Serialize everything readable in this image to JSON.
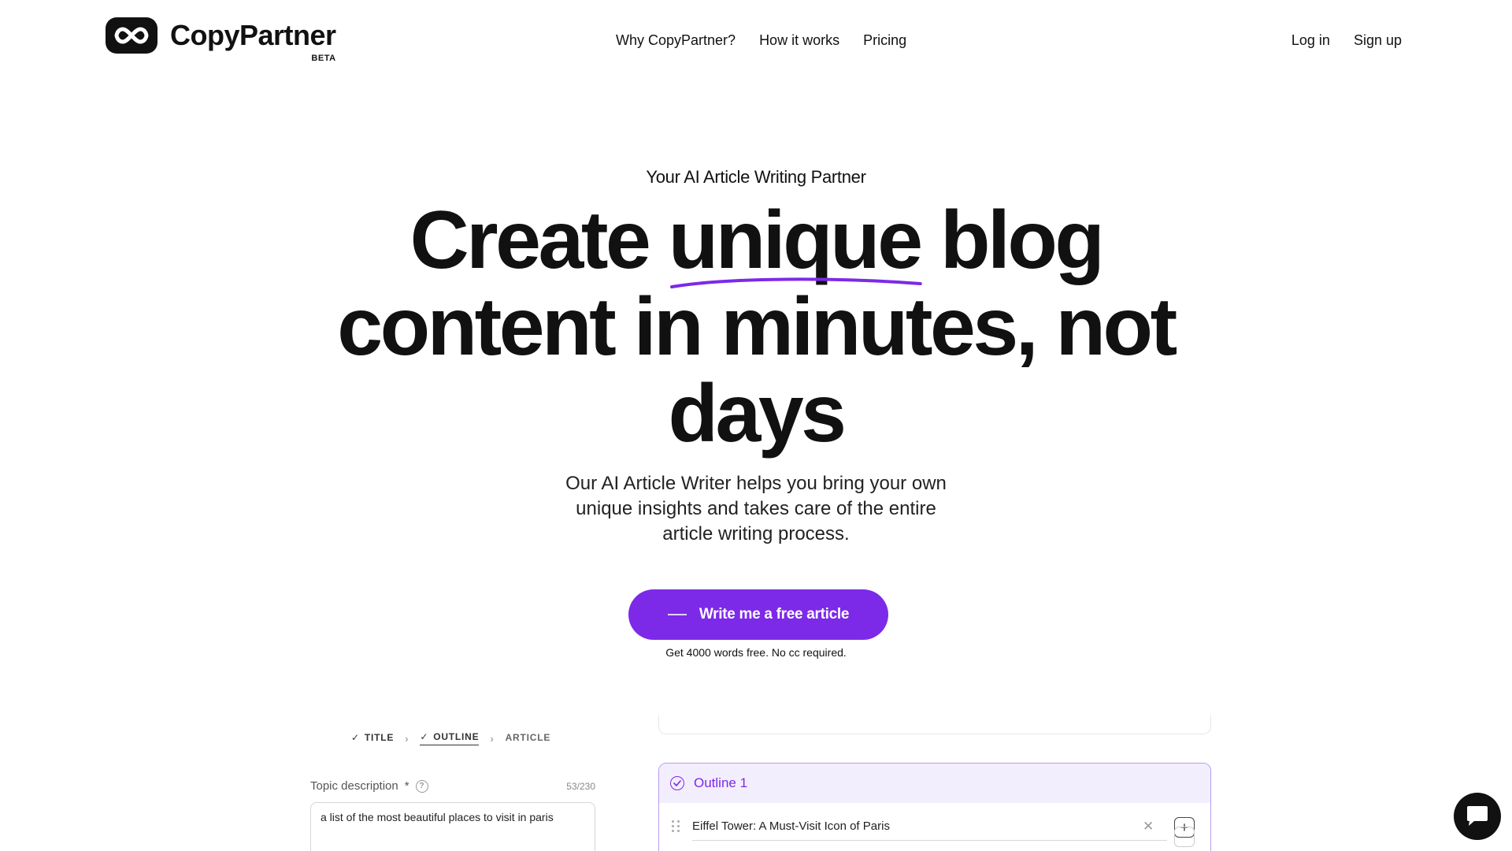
{
  "brand": {
    "name": "CopyPartner",
    "badge": "BETA",
    "logo_icon": "infinity-icon"
  },
  "nav": {
    "items": [
      "Why CopyPartner?",
      "How it works",
      "Pricing"
    ]
  },
  "auth": {
    "login": "Log in",
    "signup": "Sign up"
  },
  "hero": {
    "eyebrow": "Your AI Article Writing Partner",
    "headline_before": "Create ",
    "headline_highlight": "unique",
    "headline_after": " blog content in minutes, not days",
    "subtitle": "Our AI Article Writer helps you bring your own unique insights and takes care of the entire article writing process.",
    "cta_label": "Write me a free article",
    "cta_note": "Get 4000 words free. No cc required."
  },
  "steps": [
    {
      "label": "TITLE",
      "done": true
    },
    {
      "label": "OUTLINE",
      "done": true
    },
    {
      "label": "ARTICLE",
      "done": false
    }
  ],
  "topic": {
    "label": "Topic description",
    "required_mark": "*",
    "count": "53/230",
    "value": "a list of the most beautiful places to visit in paris"
  },
  "outline": {
    "title": "Outline 1",
    "items": [
      "Eiffel Tower: A Must-Visit Icon of Paris"
    ]
  },
  "colors": {
    "accent": "#7c2ae8",
    "accent_light": "#f3eefd",
    "accent_border": "#b79cf0",
    "text": "#111111"
  }
}
